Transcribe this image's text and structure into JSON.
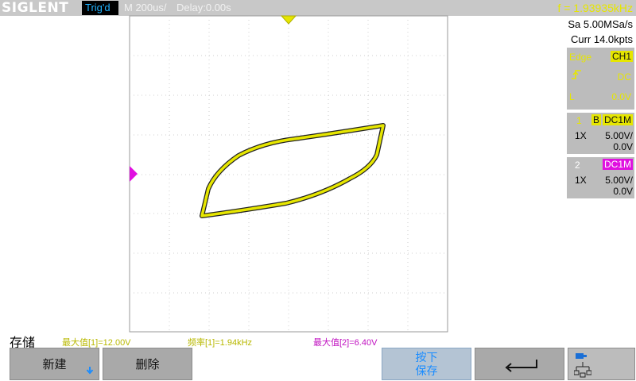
{
  "header": {
    "brand": "SIGLENT",
    "trigger_status": "Trig'd",
    "timebase": "M 200us/",
    "delay": "Delay:0.00s",
    "frequency": "f = 1.93935kHz"
  },
  "acquisition": {
    "sample_rate": "Sa 5.00MSa/s",
    "memory_depth": "Curr 14.0kpts"
  },
  "trigger_panel": {
    "type": "Edge",
    "source": "CH1",
    "slope_icon": "rising-edge-icon",
    "coupling": "DC",
    "level_label": "L",
    "level": "0.0V"
  },
  "channel1": {
    "number": "1",
    "bandwidth_tag": "B",
    "coupling": "DC1M",
    "probe": "1X",
    "scale": "5.00V/",
    "offset": "0.0V",
    "color": "#e6e600"
  },
  "channel2": {
    "number": "2",
    "coupling": "DC1M",
    "probe": "1X",
    "scale": "5.00V/",
    "offset": "0.0V",
    "color": "#e010e0"
  },
  "menu": {
    "title": "存储",
    "new_label": "新建",
    "delete_label": "删除",
    "press_save_line1": "按下",
    "press_save_line2": "保存",
    "back_icon": "back-arrow-icon",
    "network_icon": "network-icon"
  },
  "measurements": {
    "m1": "最大值[1]=12.00V",
    "m2": "频率[1]=1.94kHz",
    "m3": "最大值[2]=6.40V"
  },
  "colors": {
    "trace": "#e6e600",
    "ch2": "#e010e0",
    "accent": "#1fb3ff",
    "panel_bg": "#bcbcbc"
  }
}
